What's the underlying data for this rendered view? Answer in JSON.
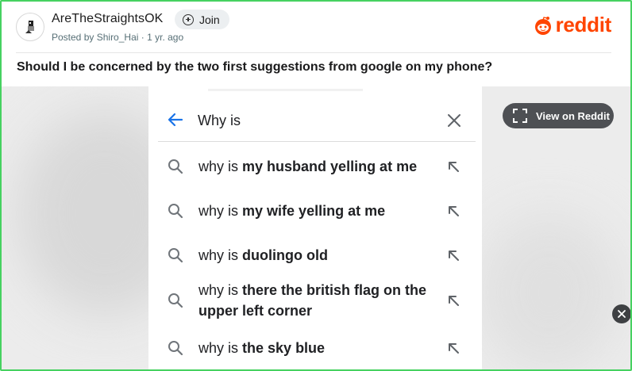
{
  "header": {
    "subreddit_name": "AreTheStraightsOK",
    "join_label": "Join",
    "posted_prefix": "Posted by",
    "author": "Shiro_Hai",
    "separator": "·",
    "age": "1 yr. ago",
    "logo_text": "reddit",
    "brand_color": "#ff4500",
    "border_color": "#46d160"
  },
  "post": {
    "title": "Should I be concerned by the two first suggestions from google on my phone?"
  },
  "phone": {
    "search_value": "Why is",
    "icons": {
      "back": "back-arrow-icon",
      "clear": "close-icon",
      "suggestion": "search-icon",
      "fill": "arrow-up-left-icon"
    },
    "suggestions": [
      {
        "prefix": "why is",
        "bold": "my husband yelling at me"
      },
      {
        "prefix": "why is",
        "bold": "my wife yelling at me"
      },
      {
        "prefix": "why is",
        "bold": "duolingo old"
      },
      {
        "prefix": "why is",
        "bold": "there the british flag on the",
        "bold2": "upper left corner"
      },
      {
        "prefix": "why is",
        "bold": "the sky blue"
      }
    ]
  },
  "overlay": {
    "view_on_reddit_label": "View on Reddit",
    "expand_icon": "expand-icon",
    "close_icon": "close-icon"
  }
}
